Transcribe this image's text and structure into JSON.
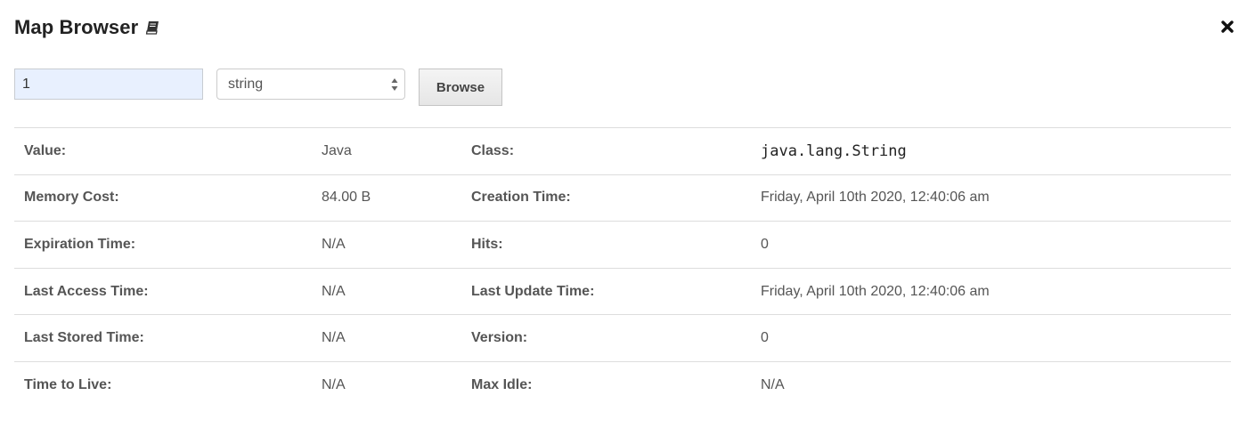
{
  "header": {
    "title": "Map Browser",
    "title_icon": "book-icon",
    "close_icon": "close-icon"
  },
  "controls": {
    "key_value": "1",
    "type_selected": "string",
    "type_arrows_icon": "select-arrows-icon",
    "browse_label": "Browse"
  },
  "details": {
    "rows": [
      {
        "label1": "Value:",
        "value1": "Java",
        "label2": "Class:",
        "value2": "java.lang.String"
      },
      {
        "label1": "Memory Cost:",
        "value1": "84.00 B",
        "label2": "Creation Time:",
        "value2": "Friday, April 10th 2020, 12:40:06 am"
      },
      {
        "label1": "Expiration Time:",
        "value1": "N/A",
        "label2": "Hits:",
        "value2": "0"
      },
      {
        "label1": "Last Access Time:",
        "value1": "N/A",
        "label2": "Last Update Time:",
        "value2": "Friday, April 10th 2020, 12:40:06 am"
      },
      {
        "label1": "Last Stored Time:",
        "value1": "N/A",
        "label2": "Version:",
        "value2": "0"
      },
      {
        "label1": "Time to Live:",
        "value1": "N/A",
        "label2": "Max Idle:",
        "value2": "N/A"
      }
    ]
  },
  "colors": {
    "input_background": "#e8f0fe",
    "row_divider": "#dddddd",
    "label_text": "#555555"
  }
}
